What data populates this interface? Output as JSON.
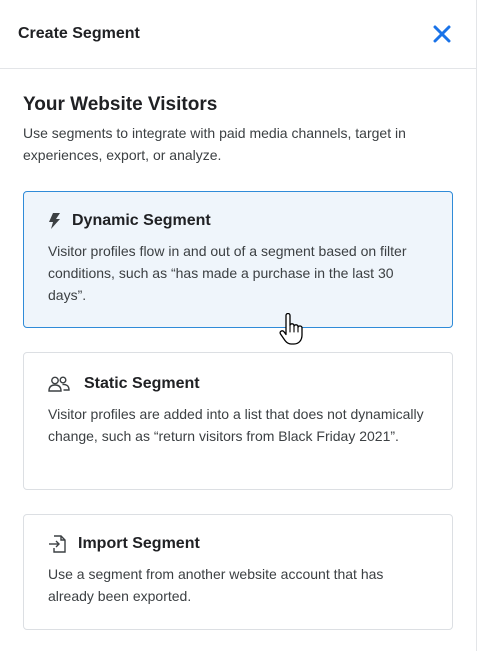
{
  "header": {
    "title": "Create Segment",
    "close_icon": "close-icon",
    "accent_color": "#1a73e8"
  },
  "intro": {
    "title": "Your Website Visitors",
    "description": "Use segments to integrate with paid media channels, target in experiences, export, or analyze."
  },
  "options": [
    {
      "icon": "lightning-icon",
      "title": "Dynamic Segment",
      "description": "Visitor profiles flow in and out of a segment based on filter conditions, such as “has made a purchase in the last 30 days”.",
      "state": "hovered"
    },
    {
      "icon": "users-icon",
      "title": "Static Segment",
      "description": "Visitor profiles are added into a list that does not dynamically change, such as “return visitors from Black Friday 2021”."
    },
    {
      "icon": "file-import-icon",
      "title": "Import Segment",
      "description": "Use a segment from another website account that has already been exported."
    }
  ]
}
